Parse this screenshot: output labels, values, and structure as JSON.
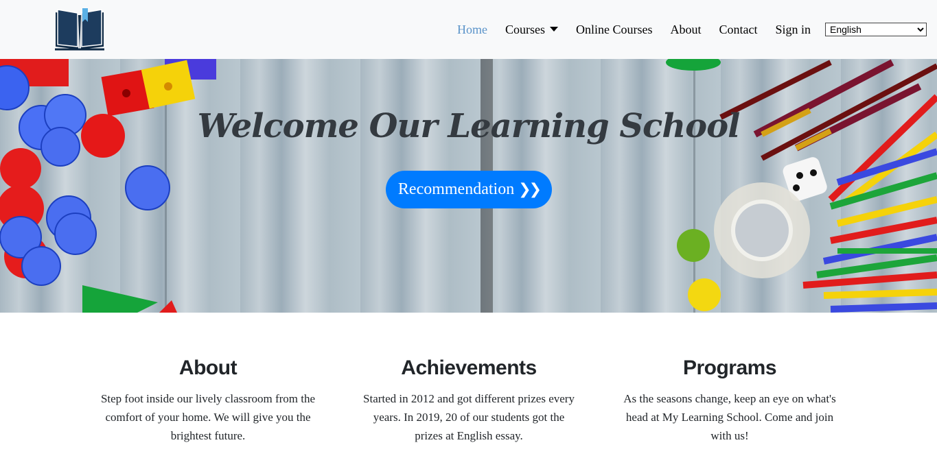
{
  "nav": {
    "logo_icon": "open-book-icon",
    "links": [
      {
        "label": "Home",
        "active": true
      },
      {
        "label": "Courses",
        "dropdown": true
      },
      {
        "label": "Online Courses"
      },
      {
        "label": "About"
      },
      {
        "label": "Contact"
      },
      {
        "label": "Sign in"
      }
    ],
    "language": {
      "selected": "English"
    }
  },
  "hero": {
    "title": "Welcome Our Learning School",
    "button_label": "Recommendation",
    "button_icon": "double-chevron-right-icon",
    "accent_color": "#007bff"
  },
  "sections": [
    {
      "title": "About",
      "text": "Step foot inside our lively classroom from the comfort of your home. We will give you the brightest future."
    },
    {
      "title": "Achievements",
      "text": "Started in 2012 and got different prizes every years. In 2019, 20 of our students got the prizes at English essay."
    },
    {
      "title": "Programs",
      "text": "As the seasons change, keep an eye on what's head at My Learning School. Come and join with us!"
    }
  ]
}
